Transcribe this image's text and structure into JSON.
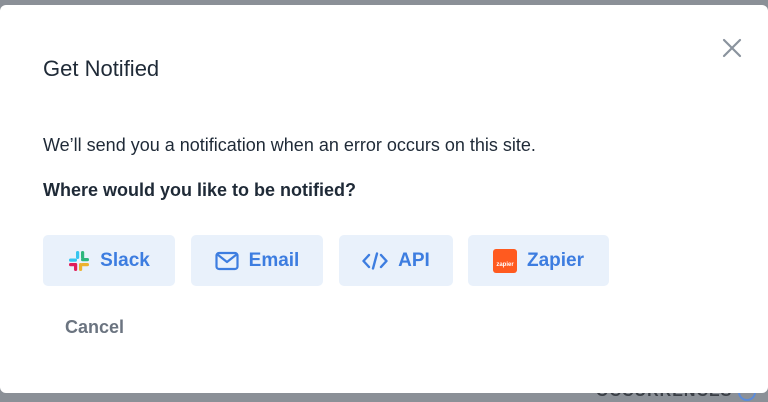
{
  "background": {
    "peek_text": "OCCURRENCES"
  },
  "modal": {
    "title": "Get Notified",
    "description": "We’ll send you a notification when an error occurs on this site.",
    "question": "Where would you like to be notified?",
    "options": [
      {
        "label": "Slack",
        "icon": "slack-icon"
      },
      {
        "label": "Email",
        "icon": "envelope-icon"
      },
      {
        "label": "API",
        "icon": "code-icon"
      },
      {
        "label": "Zapier",
        "icon": "zapier-icon",
        "icon_text": "zapier"
      }
    ],
    "cancel_label": "Cancel"
  },
  "colors": {
    "accent": "#3d7de0",
    "option_bg": "#e9f1fb",
    "zapier": "#ff5a1f",
    "text": "#1f2a37",
    "muted": "#6b7480"
  }
}
